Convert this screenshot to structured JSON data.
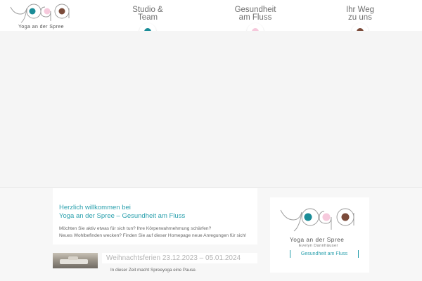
{
  "brand": {
    "logo_text": "Yoga an der Spree",
    "colors": {
      "teal": "#1a8c97",
      "pink": "#f6c9dc",
      "brown": "#7b4b3a",
      "accent_text": "#2aa0ad"
    }
  },
  "nav": {
    "items": [
      {
        "label": "Studio &\nTeam",
        "dot_color": "#1a8c97"
      },
      {
        "label": "Gesundheit\nam Fluss",
        "dot_color": "#f6c9dc"
      },
      {
        "label": "Ihr Weg\nzu uns",
        "dot_color": "#7b4b3a"
      }
    ]
  },
  "welcome": {
    "title_line1": "Herzlich willkommen bei",
    "title_line2": "Yoga an der Spree – Gesundheit am Fluss",
    "body_line1": "Möchten Sie aktiv etwas für sich tun? Ihre Körperwahrnehmung schärfen?",
    "body_line2": "Neues Wohlbefinden wecken? Finden Sie auf dieser Homepage neue Anregungen für sich!"
  },
  "news": {
    "title": "Weihnachtsferien 23.12.2023 – 05.01.2024",
    "text": "In dieser Zeit macht Spreeyoga eine Pause."
  },
  "side_card": {
    "name": "Yoga an der Spree",
    "subtitle": "Evelyn Dannhäuser",
    "link_label": "Gesundheit am Fluss"
  }
}
